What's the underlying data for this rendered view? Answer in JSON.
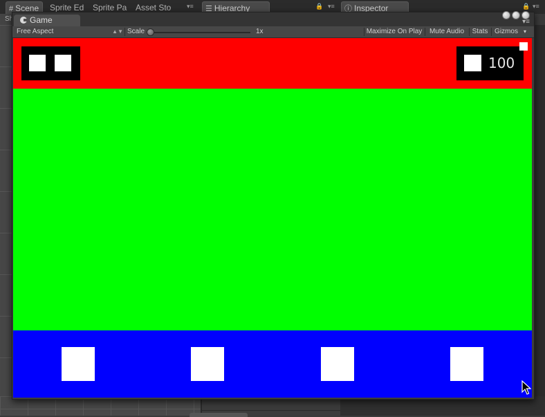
{
  "editor": {
    "tabs": [
      {
        "label": "Scene",
        "glyph": "#"
      },
      {
        "label": "Sprite Ed"
      },
      {
        "label": "Sprite Pa"
      },
      {
        "label": "Asset Sto"
      },
      {
        "label": "Hierarchy",
        "glyph": "☰"
      },
      {
        "label": "Inspector",
        "glyph": "ⓘ"
      }
    ],
    "scene_sub_label": "Sh"
  },
  "game_window": {
    "tab_label": "Game",
    "toolbar": {
      "aspect_value": "Free Aspect",
      "scale_label": "Scale",
      "scale_value": "1x",
      "scale_fraction": 0.0,
      "maximize_label": "Maximize On Play",
      "mute_label": "Mute Audio",
      "stats_label": "Stats",
      "gizmos_label": "Gizmos"
    }
  },
  "game_view": {
    "colors": {
      "top": "#ff0000",
      "middle": "#00ff00",
      "bottom": "#0000ff",
      "panel": "#000000",
      "box": "#ffffff"
    },
    "lives_count": 2,
    "score": "100",
    "control_buttons": 4
  }
}
